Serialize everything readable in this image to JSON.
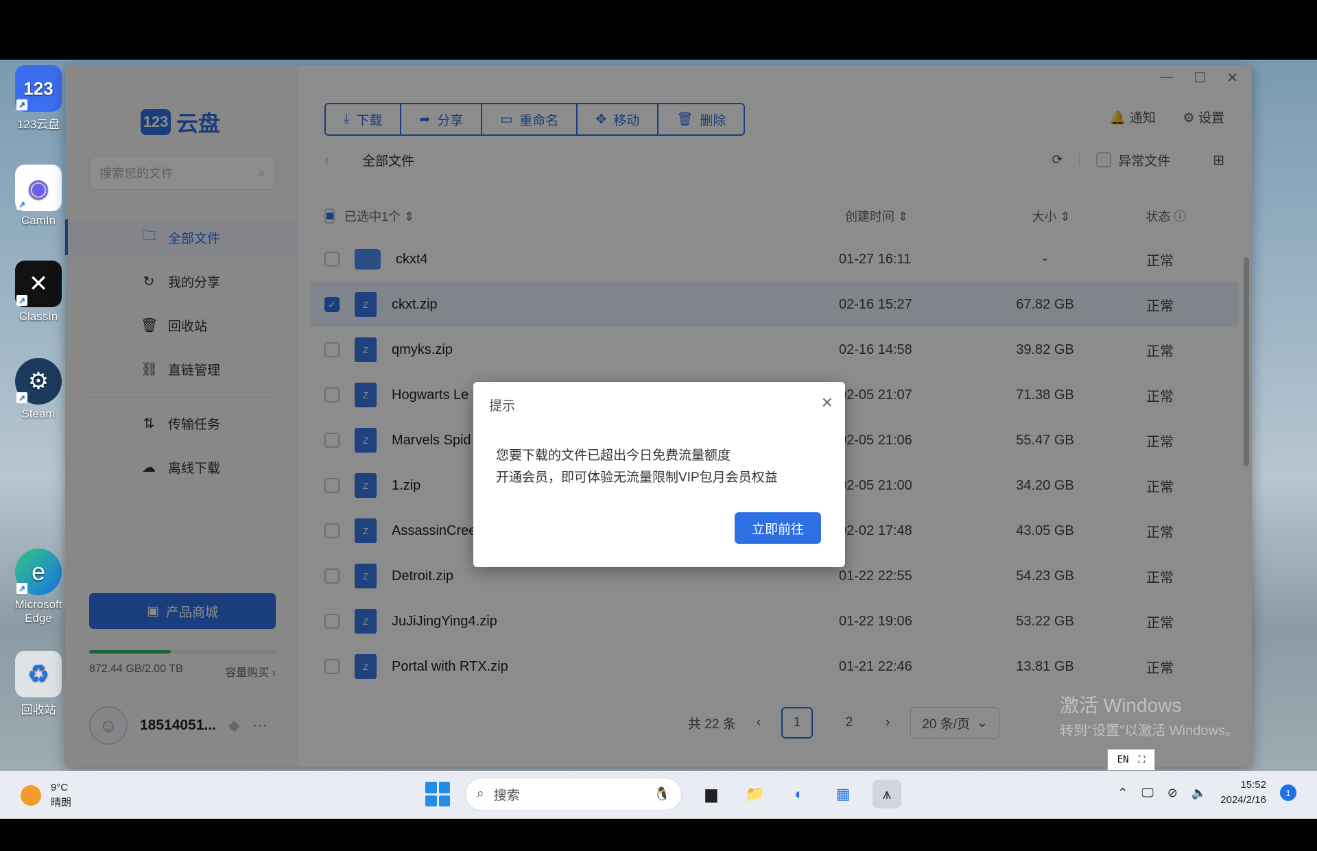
{
  "desktop": {
    "icons": [
      {
        "label": "123云盘",
        "glyph": "123"
      },
      {
        "label": "CamIn",
        "glyph": "◉"
      },
      {
        "label": "ClassIn",
        "glyph": "✕"
      },
      {
        "label": "Steam",
        "glyph": "⚙"
      },
      {
        "label": "Microsoft Edge",
        "glyph": "e"
      },
      {
        "label": "回收站",
        "glyph": "♻"
      }
    ],
    "activation_line1": "激活 Windows",
    "activation_line2": "转到\"设置\"以激活 Windows。",
    "ime": "EN"
  },
  "app": {
    "logo_mark": "123",
    "logo_text": "云盘",
    "search_placeholder": "搜索您的文件",
    "nav": [
      {
        "label": "全部文件",
        "icon": "folder-icon",
        "glyph": "🗀"
      },
      {
        "label": "我的分享",
        "icon": "share-icon",
        "glyph": "↻"
      },
      {
        "label": "回收站",
        "icon": "trash-icon",
        "glyph": "🗑"
      },
      {
        "label": "直链管理",
        "icon": "link-icon",
        "glyph": "⛓"
      },
      {
        "label": "传输任务",
        "icon": "transfer-icon",
        "glyph": "⇅"
      },
      {
        "label": "离线下载",
        "icon": "cloud-download-icon",
        "glyph": "☁"
      }
    ],
    "shop_label": "产品商城",
    "quota_used_fraction": 0.436,
    "quota_text": "872.44 GB/2.00 TB",
    "quota_buy": "容量购买 ›",
    "username": "18514051...",
    "toolbar": [
      "下载",
      "分享",
      "重命名",
      "移动",
      "删除"
    ],
    "notify_label": "通知",
    "settings_label": "设置",
    "breadcrumb": "全部文件",
    "abnormal_files": "异常文件",
    "columns": {
      "selected": "已选中1个",
      "created": "创建时间",
      "size": "大小",
      "status": "状态"
    },
    "files": [
      {
        "name": "ckxt4",
        "type": "folder",
        "time": "01-27 16:11",
        "size": "-",
        "status": "正常",
        "checked": false
      },
      {
        "name": "ckxt.zip",
        "type": "zip",
        "time": "02-16 15:27",
        "size": "67.82 GB",
        "status": "正常",
        "checked": true
      },
      {
        "name": "qmyks.zip",
        "type": "zip",
        "time": "02-16 14:58",
        "size": "39.82 GB",
        "status": "正常",
        "checked": false
      },
      {
        "name": "Hogwarts Le",
        "type": "zip",
        "time": "02-05 21:07",
        "size": "71.38 GB",
        "status": "正常",
        "checked": false
      },
      {
        "name": "Marvels Spid",
        "type": "zip",
        "time": "02-05 21:06",
        "size": "55.47 GB",
        "status": "正常",
        "checked": false
      },
      {
        "name": "1.zip",
        "type": "zip",
        "time": "02-05 21:00",
        "size": "34.20 GB",
        "status": "正常",
        "checked": false
      },
      {
        "name": "AssassinCreed Unity.zip",
        "type": "zip",
        "time": "02-02 17:48",
        "size": "43.05 GB",
        "status": "正常",
        "checked": false
      },
      {
        "name": "Detroit.zip",
        "type": "zip",
        "time": "01-22 22:55",
        "size": "54.23 GB",
        "status": "正常",
        "checked": false
      },
      {
        "name": "JuJiJingYing4.zip",
        "type": "zip",
        "time": "01-22 19:06",
        "size": "53.22 GB",
        "status": "正常",
        "checked": false
      },
      {
        "name": "Portal with RTX.zip",
        "type": "zip",
        "time": "01-21 22:46",
        "size": "13.81 GB",
        "status": "正常",
        "checked": false
      }
    ],
    "pagination": {
      "total": "共 22 条",
      "current": "1",
      "next_page": "2",
      "page_size": "20 条/页"
    }
  },
  "dialog": {
    "title": "提示",
    "line1": "您要下载的文件已超出今日免费流量额度",
    "line2": "开通会员，即可体验无流量限制VIP包月会员权益",
    "button": "立即前往"
  },
  "taskbar": {
    "temp": "9°C",
    "weather": "晴朗",
    "search": "搜索",
    "time": "15:52",
    "date": "2024/2/16",
    "notifications": "1"
  }
}
